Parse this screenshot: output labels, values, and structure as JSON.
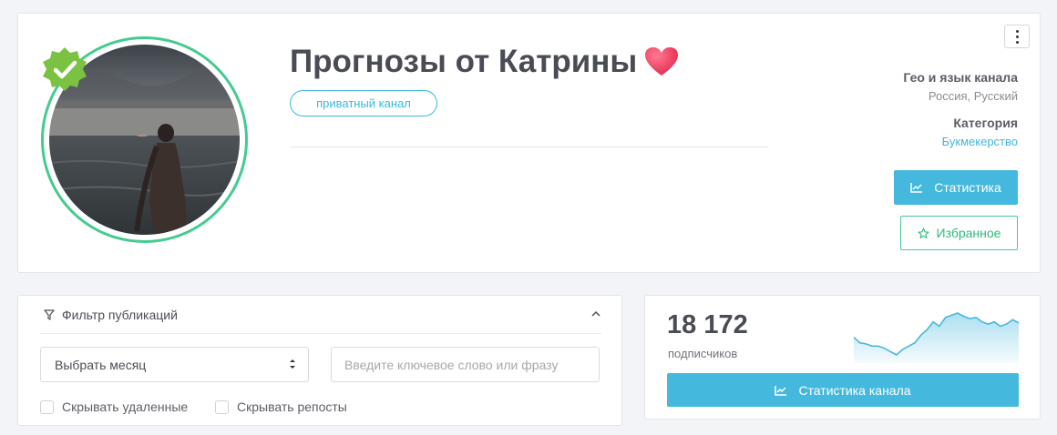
{
  "channel": {
    "title": "Прогнозы от Катрины",
    "private_badge": "приватный канал",
    "verified": true
  },
  "meta": {
    "geo_label": "Гео и язык канала",
    "geo_value": "Россия, Русский",
    "category_label": "Категория",
    "category_value": "Букмекерство"
  },
  "buttons": {
    "stats": "Статистика",
    "favorite": "Избранное",
    "channel_stats": "Статистика канала"
  },
  "filter": {
    "header": "Фильтр публикаций",
    "month_select": "Выбрать месяц",
    "search_placeholder": "Введите ключевое слово или фразу",
    "hide_deleted": "Скрывать удаленные",
    "hide_reposts": "Скрывать репосты"
  },
  "subscribers": {
    "count": "18 172",
    "label": "подписчиков",
    "trend": [
      38,
      33,
      32,
      30,
      30,
      28,
      25,
      22,
      27,
      30,
      33,
      40,
      45,
      52,
      48,
      56,
      58,
      60,
      57,
      55,
      56,
      52,
      50,
      52,
      48,
      50,
      54,
      51
    ]
  },
  "colors": {
    "accent_blue": "#45b8dd",
    "accent_green": "#44cb8f",
    "verified_green": "#7cc242",
    "heart": "#f0395b"
  },
  "icons": {
    "verified": "verified-badge-icon",
    "heart": "heart-icon",
    "menu": "more-vertical-icon",
    "stats": "chart-line-icon",
    "favorite": "star-icon",
    "filter": "funnel-icon",
    "collapse": "chevron-up-icon",
    "select": "sort-arrows-icon"
  }
}
